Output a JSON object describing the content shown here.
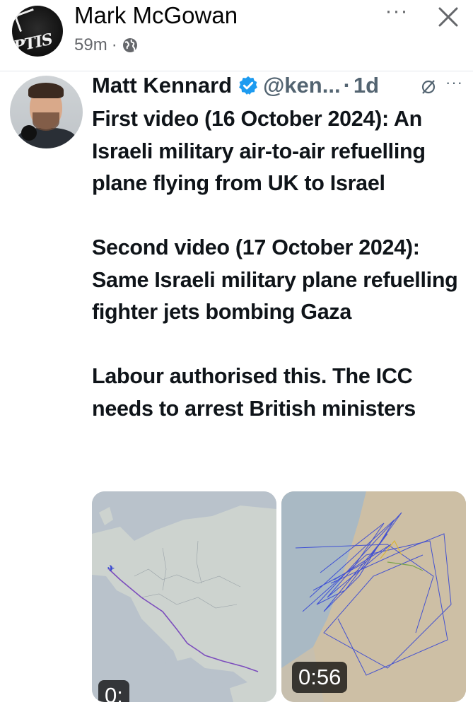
{
  "facebook_post": {
    "author": "Mark McGowan",
    "time": "59m",
    "separator": "·",
    "avatar_text": "PTIS",
    "icons": {
      "audience": "globe-icon",
      "more": "more-options-icon",
      "close": "close-icon"
    },
    "more_label": "···"
  },
  "tweet": {
    "author": "Matt Kennard",
    "handle": "@ken...",
    "separator": "·",
    "time": "1d",
    "more_label": "···",
    "icons": {
      "verified": "verified-badge-icon",
      "grok": "grok-icon"
    },
    "text": {
      "line1": "First video (16 October 2024): An Israeli military air-to-air refuelling plane flying from UK to Israel",
      "line2": "Second video (17 October 2024): Same Israeli military plane refuelling fighter jets bombing Gaza",
      "line3": "Labour authorised this. The ICC needs to arrest British ministers"
    },
    "media": [
      {
        "kind": "video",
        "description": "flight-map-europe",
        "duration": "0:"
      },
      {
        "kind": "video",
        "description": "flight-map-gaza",
        "duration": "0:56"
      }
    ]
  },
  "colors": {
    "verified_blue": "#1d9bf0",
    "flight_path_purple": "#7c4dbd",
    "track_blue": "#2d3fd8"
  }
}
